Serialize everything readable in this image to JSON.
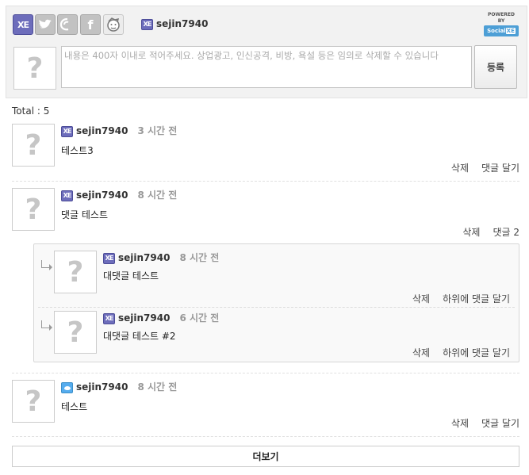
{
  "services": {
    "xe_label": "XE",
    "facebook_label": "f"
  },
  "current_user": "sejin7940",
  "powered": {
    "label": "POWERED BY",
    "brand_prefix": "Social",
    "brand_suffix": "XE"
  },
  "composer": {
    "placeholder": "내용은 400자 이내로 적어주세요. 상업광고, 인신공격, 비방, 욕설 등은 임의로 삭제할 수 있습니다",
    "submit_label": "등록"
  },
  "total_label": "Total : 5",
  "avatar_glyph": "?",
  "comments": [
    {
      "service": "xe",
      "author": "sejin7940",
      "time": "3 시간 전",
      "body": "테스트3",
      "delete_label": "삭제",
      "reply_label": "댓글 달기"
    },
    {
      "service": "xe",
      "author": "sejin7940",
      "time": "8 시간 전",
      "body": "댓글 테스트",
      "delete_label": "삭제",
      "reply_label": "댓글 2"
    },
    {
      "service": "twitter",
      "author": "sejin7940",
      "time": "8 시간 전",
      "body": "테스트",
      "delete_label": "삭제",
      "reply_label": "댓글 달기"
    }
  ],
  "replies": [
    {
      "service": "xe",
      "author": "sejin7940",
      "time": "8 시간 전",
      "body": "대댓글 테스트",
      "delete_label": "삭제",
      "reply_label": "하위에 댓글 달기"
    },
    {
      "service": "xe",
      "author": "sejin7940",
      "time": "6 시간 전",
      "body": "대댓글 테스트 #2",
      "delete_label": "삭제",
      "reply_label": "하위에 댓글 달기"
    }
  ],
  "more_label": "더보기",
  "colors": {
    "xe_purple": "#6d6dbb",
    "twitter_blue": "#55acee",
    "time_gray": "#999999"
  }
}
